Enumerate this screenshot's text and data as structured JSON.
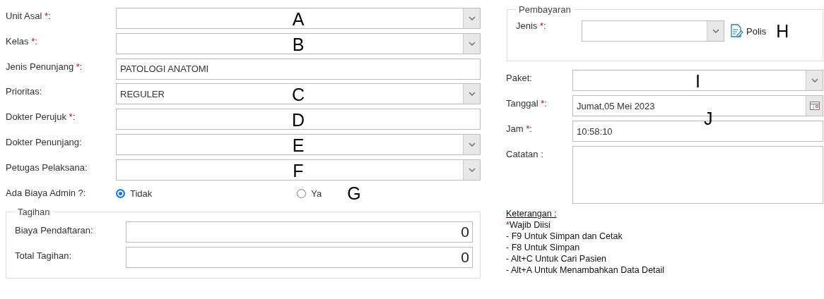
{
  "left_fields": [
    {
      "label": "Unit Asal",
      "mark": "*",
      "end": ":",
      "kind": "select",
      "marker": "A"
    },
    {
      "label": "Kelas",
      "mark": "*",
      "end": ":",
      "kind": "select",
      "marker": "B"
    },
    {
      "label": "Jenis Penunjang",
      "mark": "*",
      "end": ":",
      "kind": "text",
      "value": "PATOLOGI ANATOMI"
    },
    {
      "label": "Prioritas:",
      "kind": "select",
      "value": "REGULER",
      "marker": "C"
    },
    {
      "label": "Dokter Perujuk",
      "mark": "*",
      "end": ":",
      "kind": "text",
      "marker": "D"
    },
    {
      "label": "Dokter Penunjang:",
      "kind": "select",
      "marker": "E"
    },
    {
      "label": "Petugas Pelaksana:",
      "kind": "select",
      "marker": "F"
    }
  ],
  "admin_fee": {
    "label": "Ada Biaya Admin ?:",
    "options": [
      {
        "label": "Tidak",
        "selected": true
      },
      {
        "label": "Ya",
        "selected": false
      }
    ],
    "marker": "G"
  },
  "billing": {
    "title": "Tagihan",
    "fields": [
      {
        "label": "Biaya Pendaftaran:",
        "value": "0"
      },
      {
        "label": "Total Tagihan:",
        "value": "0"
      }
    ]
  },
  "payment": {
    "title": "Pembayaran",
    "label": "Jenis",
    "mark": "*",
    "end": ":",
    "link": "Polis",
    "marker": "H"
  },
  "right_fields": [
    {
      "label": "Paket:",
      "kind": "select",
      "marker": "I"
    },
    {
      "label": "Tanggal",
      "mark": "*",
      "end": ":",
      "kind": "date",
      "value": "Jumat,05 Mei 2023",
      "marker": "J"
    },
    {
      "label": "Jam",
      "mark": "*",
      "end": ":",
      "kind": "text",
      "value": "10:58:10"
    },
    {
      "label": "Catatan :",
      "kind": "textarea"
    }
  ],
  "notes": {
    "title": "Keterangan :",
    "lines": [
      {
        "mark": "*",
        "text": "Wajib Diisi"
      },
      {
        "text": "- F9 Untuk Simpan dan Cetak"
      },
      {
        "text": "- F8 Untuk Simpan"
      },
      {
        "text": "- Alt+C Untuk Cari Pasien"
      },
      {
        "text": "- Alt+A Untuk Menambahkan Data Detail"
      }
    ]
  }
}
